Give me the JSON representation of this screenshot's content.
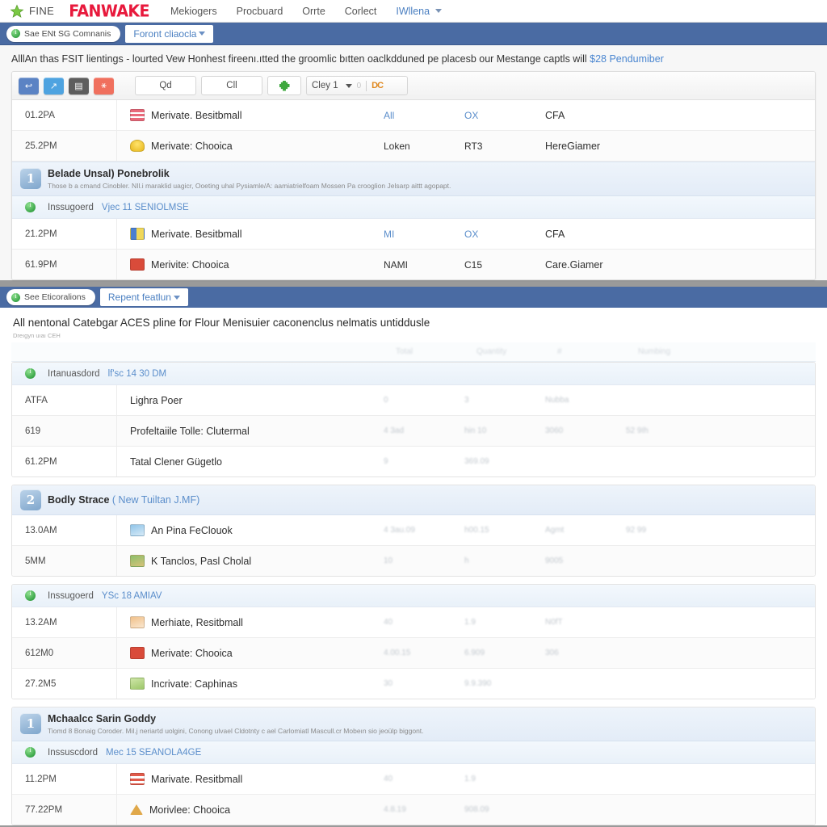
{
  "topnav": {
    "star_icon": "star-icon",
    "brand_small": "FINE",
    "brand_logo": "FANWAKE",
    "links": [
      "Mekiogers",
      "Procbuard",
      "Orrte",
      "Corlect"
    ],
    "user": "IWllena"
  },
  "banner1": {
    "status_pill": "Sae ENt SG Comnanis",
    "tab": "Foront cliaocla"
  },
  "headline": {
    "text": "AlllAn thas FSIT lientings - lourted Vew Honhest fireenı.ıtted the groomlic bıtten oaclkdduned pe placesb our Mestange captls will ",
    "link": "$28 Pendumiber"
  },
  "toolbar": {
    "icon_buttons": [
      {
        "name": "reply-icon",
        "glyph": "↩",
        "color": "#5b83c4"
      },
      {
        "name": "forward-icon",
        "glyph": "↗",
        "color": "#4ea3e0"
      },
      {
        "name": "archive-icon",
        "glyph": "▤",
        "color": "#5e5e5e"
      },
      {
        "name": "delete-icon",
        "glyph": "✖",
        "color": "#f0705e"
      }
    ],
    "btn_qd": "Qd",
    "btn_cll": "Cll",
    "puzzle_icon": "puzzle-icon",
    "select_value": "Cley 1",
    "select_faded": "0",
    "select_orange": "DC"
  },
  "panel1": {
    "rows_top": [
      {
        "time": "01.2PA",
        "icon": "flag-red-icon",
        "icon_class": "ico-flagred",
        "name": "Merivate. Besitbmall",
        "c1": "All",
        "c1_link": true,
        "c2": "OX",
        "c2_link": true,
        "c3": "CFA"
      },
      {
        "time": "25.2PM",
        "icon": "bulb-icon",
        "icon_class": "ico-bulb",
        "name": "Merivate: Chooica",
        "c1": "Loken",
        "c1_link": false,
        "c2": "RT3",
        "c2_link": false,
        "c3": "HereGiamer"
      }
    ],
    "section": {
      "avatar": "1",
      "title": "Belade Unsal) Ponebrolik",
      "desc": "Those b a cmand Cinobler. NIl.i maraklid uagicr, Ooeting uhal Pysiamle/A: aamiatrielfoam Mossen Pa crooglion Jelsarp aittt agopapt."
    },
    "status": {
      "label": "Inssugoerd",
      "link": "Vjec 11 SENIOLMSE"
    },
    "rows_bottom": [
      {
        "time": "21.2PM",
        "icon": "bluebar-icon",
        "icon_class": "ico-bluebar",
        "name": "Merivate. Besitbmall",
        "c1": "MI",
        "c1_link": true,
        "c2": "OX",
        "c2_link": true,
        "c3": "CFA"
      },
      {
        "time": "61.9PM",
        "icon": "red-figure-icon",
        "icon_class": "ico-redfig",
        "name": "Merivite: Chooica",
        "c1": "NAMI",
        "c1_link": false,
        "c2": "C15",
        "c2_link": false,
        "c3": "Care.Giamer"
      }
    ]
  },
  "banner2": {
    "status_pill": "See Eticoralions",
    "tab": "Repent featlun"
  },
  "panel2": {
    "title": "All nentonal Catebgar ACES pline for Flour Menisuier caconenclus nelmatis untiddusle",
    "subtitle": "Dreıgyn uıaı CEH",
    "col_headers": [
      "",
      "",
      "Total",
      "Quantity",
      "#",
      "Numbing"
    ],
    "groups": [
      {
        "kind": "status",
        "label": "Irtanuasdord",
        "link": "lf'sc 14 30 DM",
        "rows": [
          {
            "time": "ATFA",
            "icon_class": "",
            "name": "Lighra Poer",
            "v1": "0",
            "v2": "3",
            "v3": "Nubba",
            "v4": ""
          },
          {
            "time": "619",
            "icon_class": "",
            "name": "Profeltaiile Tolle: Clutermal",
            "v1": "4 3ad",
            "v2": "hin 10",
            "v3": "3060",
            "v4": "52 9Ih"
          },
          {
            "time": "61.2PM",
            "icon_class": "",
            "name": "Tatal Clener Gügetlo",
            "v1": "9",
            "v2": "369.09",
            "v3": "",
            "v4": ""
          }
        ]
      },
      {
        "kind": "section",
        "avatar": "2",
        "title": "Bodly Strace",
        "title_sub": "( New Tuiltan J.MF)",
        "rows": [
          {
            "time": "13.0AM",
            "icon_class": "ico-photo",
            "name": "An Pina FeClouok",
            "v1": "4 3au.09",
            "v2": "h00.15",
            "v3": "Agmt",
            "v4": "92 99"
          },
          {
            "time": "5MM",
            "icon_class": "ico-green",
            "name": "K Tanclos, Pasl Cholal",
            "v1": "10",
            "v2": "h",
            "v3": "9005",
            "v4": ""
          }
        ]
      },
      {
        "kind": "status",
        "label": "Inssugoerd",
        "link": "YSc 18 AMIAV",
        "rows": [
          {
            "time": "13.2AM",
            "icon_class": "ico-peach",
            "name": "Merhiate, Resitbmall",
            "v1": "40",
            "v2": "1.9",
            "v3": "N0fT",
            "v4": ""
          },
          {
            "time": "612M0",
            "icon_class": "ico-redfig",
            "name": "Merivate: Chooica",
            "v1": "4.00.15",
            "v2": "6.909",
            "v3": "306",
            "v4": ""
          },
          {
            "time": "27.2M5",
            "icon_class": "ico-screen",
            "name": "Incrivate: Caphinas",
            "v1": "30",
            "v2": "9.9.390",
            "v3": "",
            "v4": ""
          }
        ]
      },
      {
        "kind": "section",
        "avatar": "1",
        "title": "Mchaalcc Sarin Goddy",
        "title_sub": "",
        "desc": "Tiomd 8 Bonaig Coroder. Mil.j neriartd uolgini, Conong ulvael Cldotnty c ael Carlomiatl Mascull.cr Mobeın sio jeoülp biggont.",
        "rows": []
      },
      {
        "kind": "status",
        "label": "Inssuscdord",
        "link": "Mec 15 SEANOLA4GE",
        "rows": [
          {
            "time": "11.2PM",
            "icon_class": "ico-stripe",
            "name": "Marivate. Resitbmall",
            "v1": "40",
            "v2": "1.9",
            "v3": "",
            "v4": ""
          },
          {
            "time": "77.22PM",
            "icon_class": "ico-tower",
            "name": "Morivlee: Chooica",
            "v1": "4.8.19",
            "v2": "908.09",
            "v3": "",
            "v4": ""
          }
        ]
      }
    ]
  }
}
